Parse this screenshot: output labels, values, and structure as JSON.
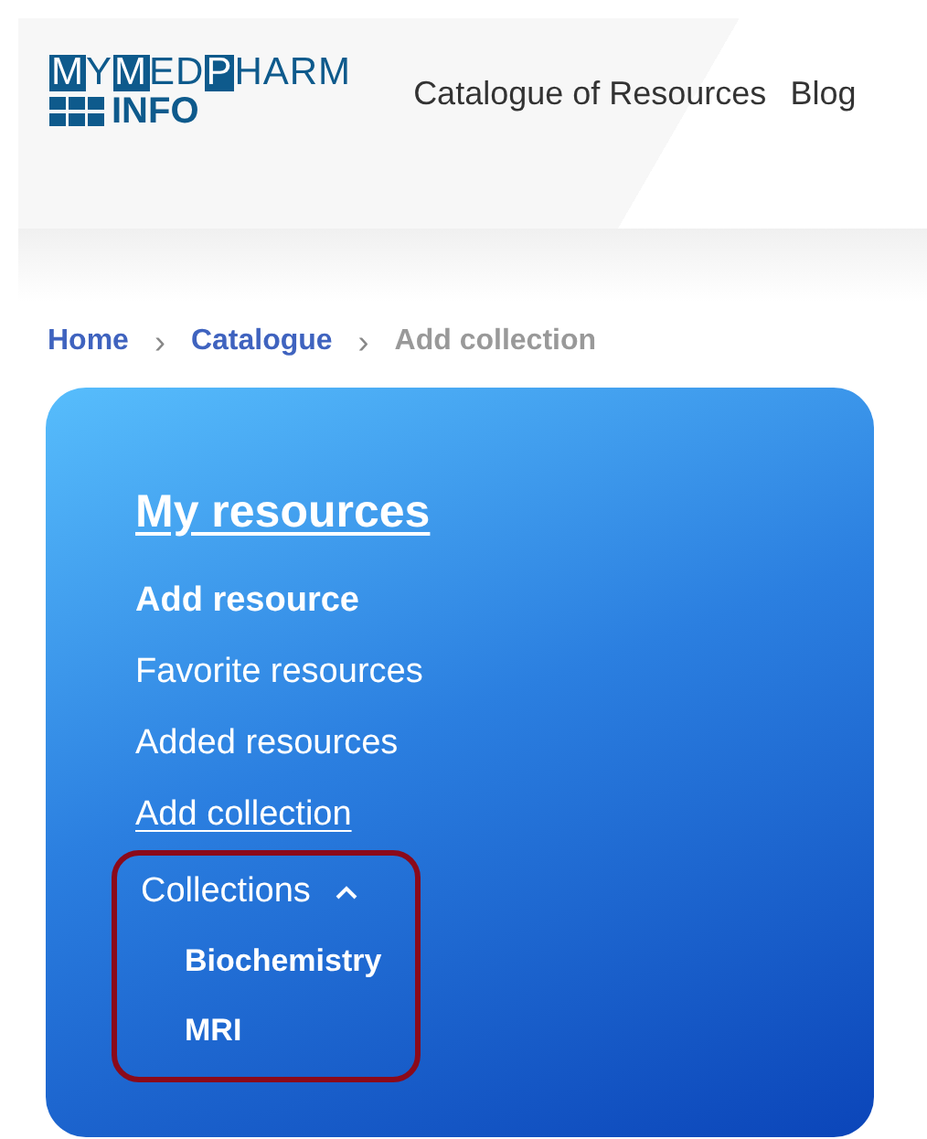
{
  "logo": {
    "letters": [
      {
        "text": "M",
        "boxed": true
      },
      {
        "text": "Y",
        "boxed": false
      },
      {
        "text": "M",
        "boxed": true
      },
      {
        "text": "ED",
        "boxed": false
      },
      {
        "text": "P",
        "boxed": true
      },
      {
        "text": "HARM",
        "boxed": false
      }
    ],
    "subtitle": "INFO"
  },
  "nav": [
    "Catalogue of Resources",
    "Blog"
  ],
  "breadcrumb": [
    {
      "label": "Home",
      "current": false
    },
    {
      "label": "Catalogue",
      "current": false
    },
    {
      "label": "Add collection",
      "current": true
    }
  ],
  "separator": "›",
  "menu": {
    "title": "My resources",
    "items": [
      {
        "kind": "bold",
        "label": "Add resource",
        "selected": false
      },
      {
        "kind": "plain",
        "label": "Favorite resources",
        "selected": false
      },
      {
        "kind": "plain",
        "label": "Added resources",
        "selected": false
      },
      {
        "kind": "plain",
        "label": "Add collection",
        "selected": true
      },
      {
        "kind": "group",
        "label": "Collections",
        "selected": false,
        "expanded": true,
        "highlighted": true,
        "children": [
          {
            "label": "Biochemistry"
          },
          {
            "label": "MRI"
          }
        ]
      }
    ]
  }
}
